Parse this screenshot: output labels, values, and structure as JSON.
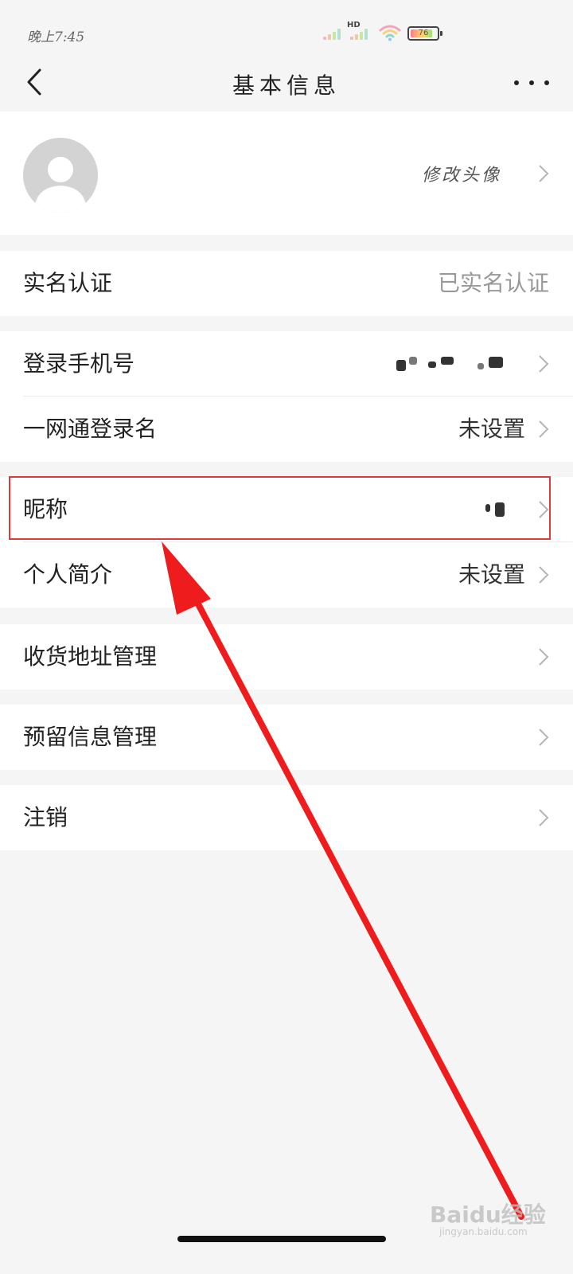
{
  "status_bar": {
    "time": "晚上7:45",
    "network_label": "HD",
    "battery_level": "76"
  },
  "nav": {
    "title": "基本信息",
    "back_icon": "chevron-left-icon",
    "more_icon": "more-horizontal-icon"
  },
  "avatar_section": {
    "edit_label": "修改头像"
  },
  "rows": {
    "real_name": {
      "label": "实名认证",
      "value": "已实名认证"
    },
    "phone": {
      "label": "登录手机号"
    },
    "login_name": {
      "label": "一网通登录名",
      "value": "未设置"
    },
    "nickname": {
      "label": "昵称"
    },
    "bio": {
      "label": "个人简介",
      "value": "未设置"
    },
    "address": {
      "label": "收货地址管理"
    },
    "reserved_info": {
      "label": "预留信息管理"
    },
    "cancel_account": {
      "label": "注销"
    }
  },
  "annotation": {
    "highlight_color": "#e03a3a",
    "arrow_color": "#ee1c1c"
  },
  "watermark": {
    "text": "Baidu经验",
    "sub": "jingyan.baidu.com"
  }
}
